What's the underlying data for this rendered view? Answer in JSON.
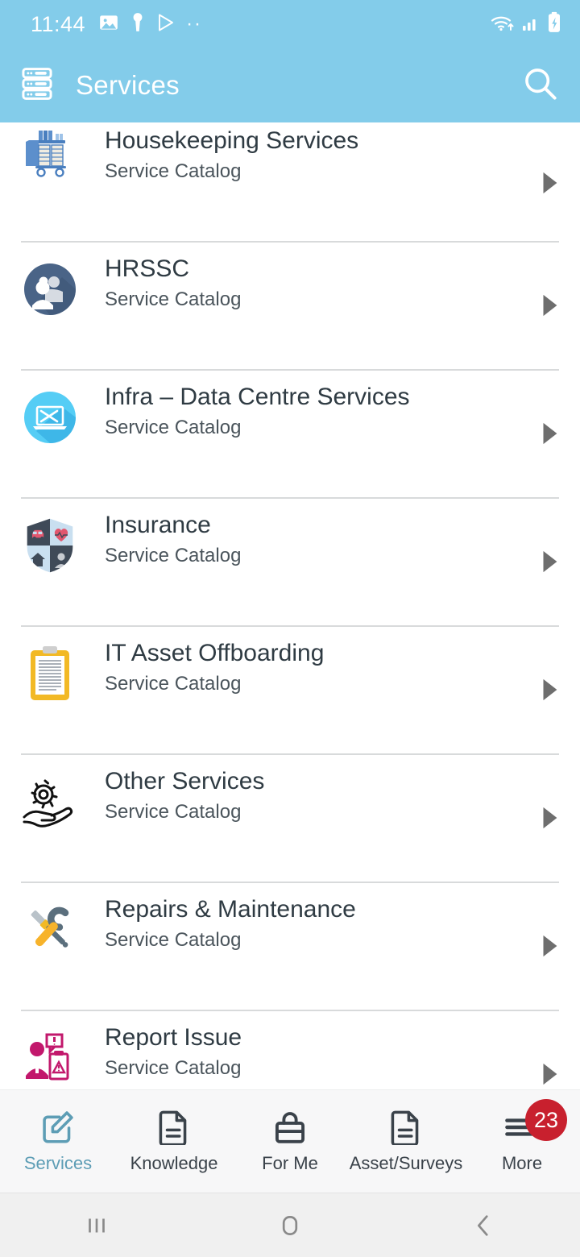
{
  "status_bar": {
    "time": "11:44",
    "left_icons": [
      "image-icon",
      "person-key-icon",
      "play-store-icon",
      "more-dots-icon"
    ],
    "dots": "··",
    "right_icons": [
      "wifi-icon",
      "cellular-signal-icon",
      "battery-charging-icon"
    ]
  },
  "app_bar": {
    "menu_icon": "server-rack-icon",
    "title": "Services",
    "search_icon": "search-icon"
  },
  "colors": {
    "header_bg": "#83ccea",
    "accent": "#5d9db5",
    "badge_bg": "#c8202e",
    "divider": "#d8dadb",
    "title_text": "#2f3b43",
    "sub_text": "#4b555c",
    "bottom_nav_bg": "#f7f7f8",
    "system_nav_bg": "#f0f0f0"
  },
  "list": {
    "subtitle_label": "Service Catalog",
    "items": [
      {
        "title": "Housekeeping Services",
        "subtitle": "Service Catalog",
        "icon": "housekeeping-cart-icon"
      },
      {
        "title": "HRSSC",
        "subtitle": "Service Catalog",
        "icon": "people-group-icon"
      },
      {
        "title": "Infra – Data Centre Services",
        "subtitle": "Service Catalog",
        "icon": "laptop-tools-icon"
      },
      {
        "title": "Insurance",
        "subtitle": "Service Catalog",
        "icon": "shield-insurance-icon"
      },
      {
        "title": "IT Asset Offboarding",
        "subtitle": "Service Catalog",
        "icon": "clipboard-icon"
      },
      {
        "title": "Other Services",
        "subtitle": "Service Catalog",
        "icon": "hand-gear-icon"
      },
      {
        "title": "Repairs & Maintenance",
        "subtitle": "Service Catalog",
        "icon": "wrench-screwdriver-icon"
      },
      {
        "title": "Report Issue",
        "subtitle": "Service Catalog",
        "icon": "person-report-icon"
      }
    ]
  },
  "bottom_nav": {
    "items": [
      {
        "label": "Services",
        "icon": "edit-note-icon",
        "active": true,
        "badge": ""
      },
      {
        "label": "Knowledge",
        "icon": "document-icon",
        "active": false,
        "badge": ""
      },
      {
        "label": "For Me",
        "icon": "briefcase-icon",
        "active": false,
        "badge": ""
      },
      {
        "label": "Asset/Surveys",
        "icon": "document-icon",
        "active": false,
        "badge": ""
      },
      {
        "label": "More",
        "icon": "hamburger-menu-icon",
        "active": false,
        "badge": "23"
      }
    ]
  },
  "system_nav": {
    "recents": "recents-icon",
    "home": "home-icon",
    "back": "back-icon"
  }
}
